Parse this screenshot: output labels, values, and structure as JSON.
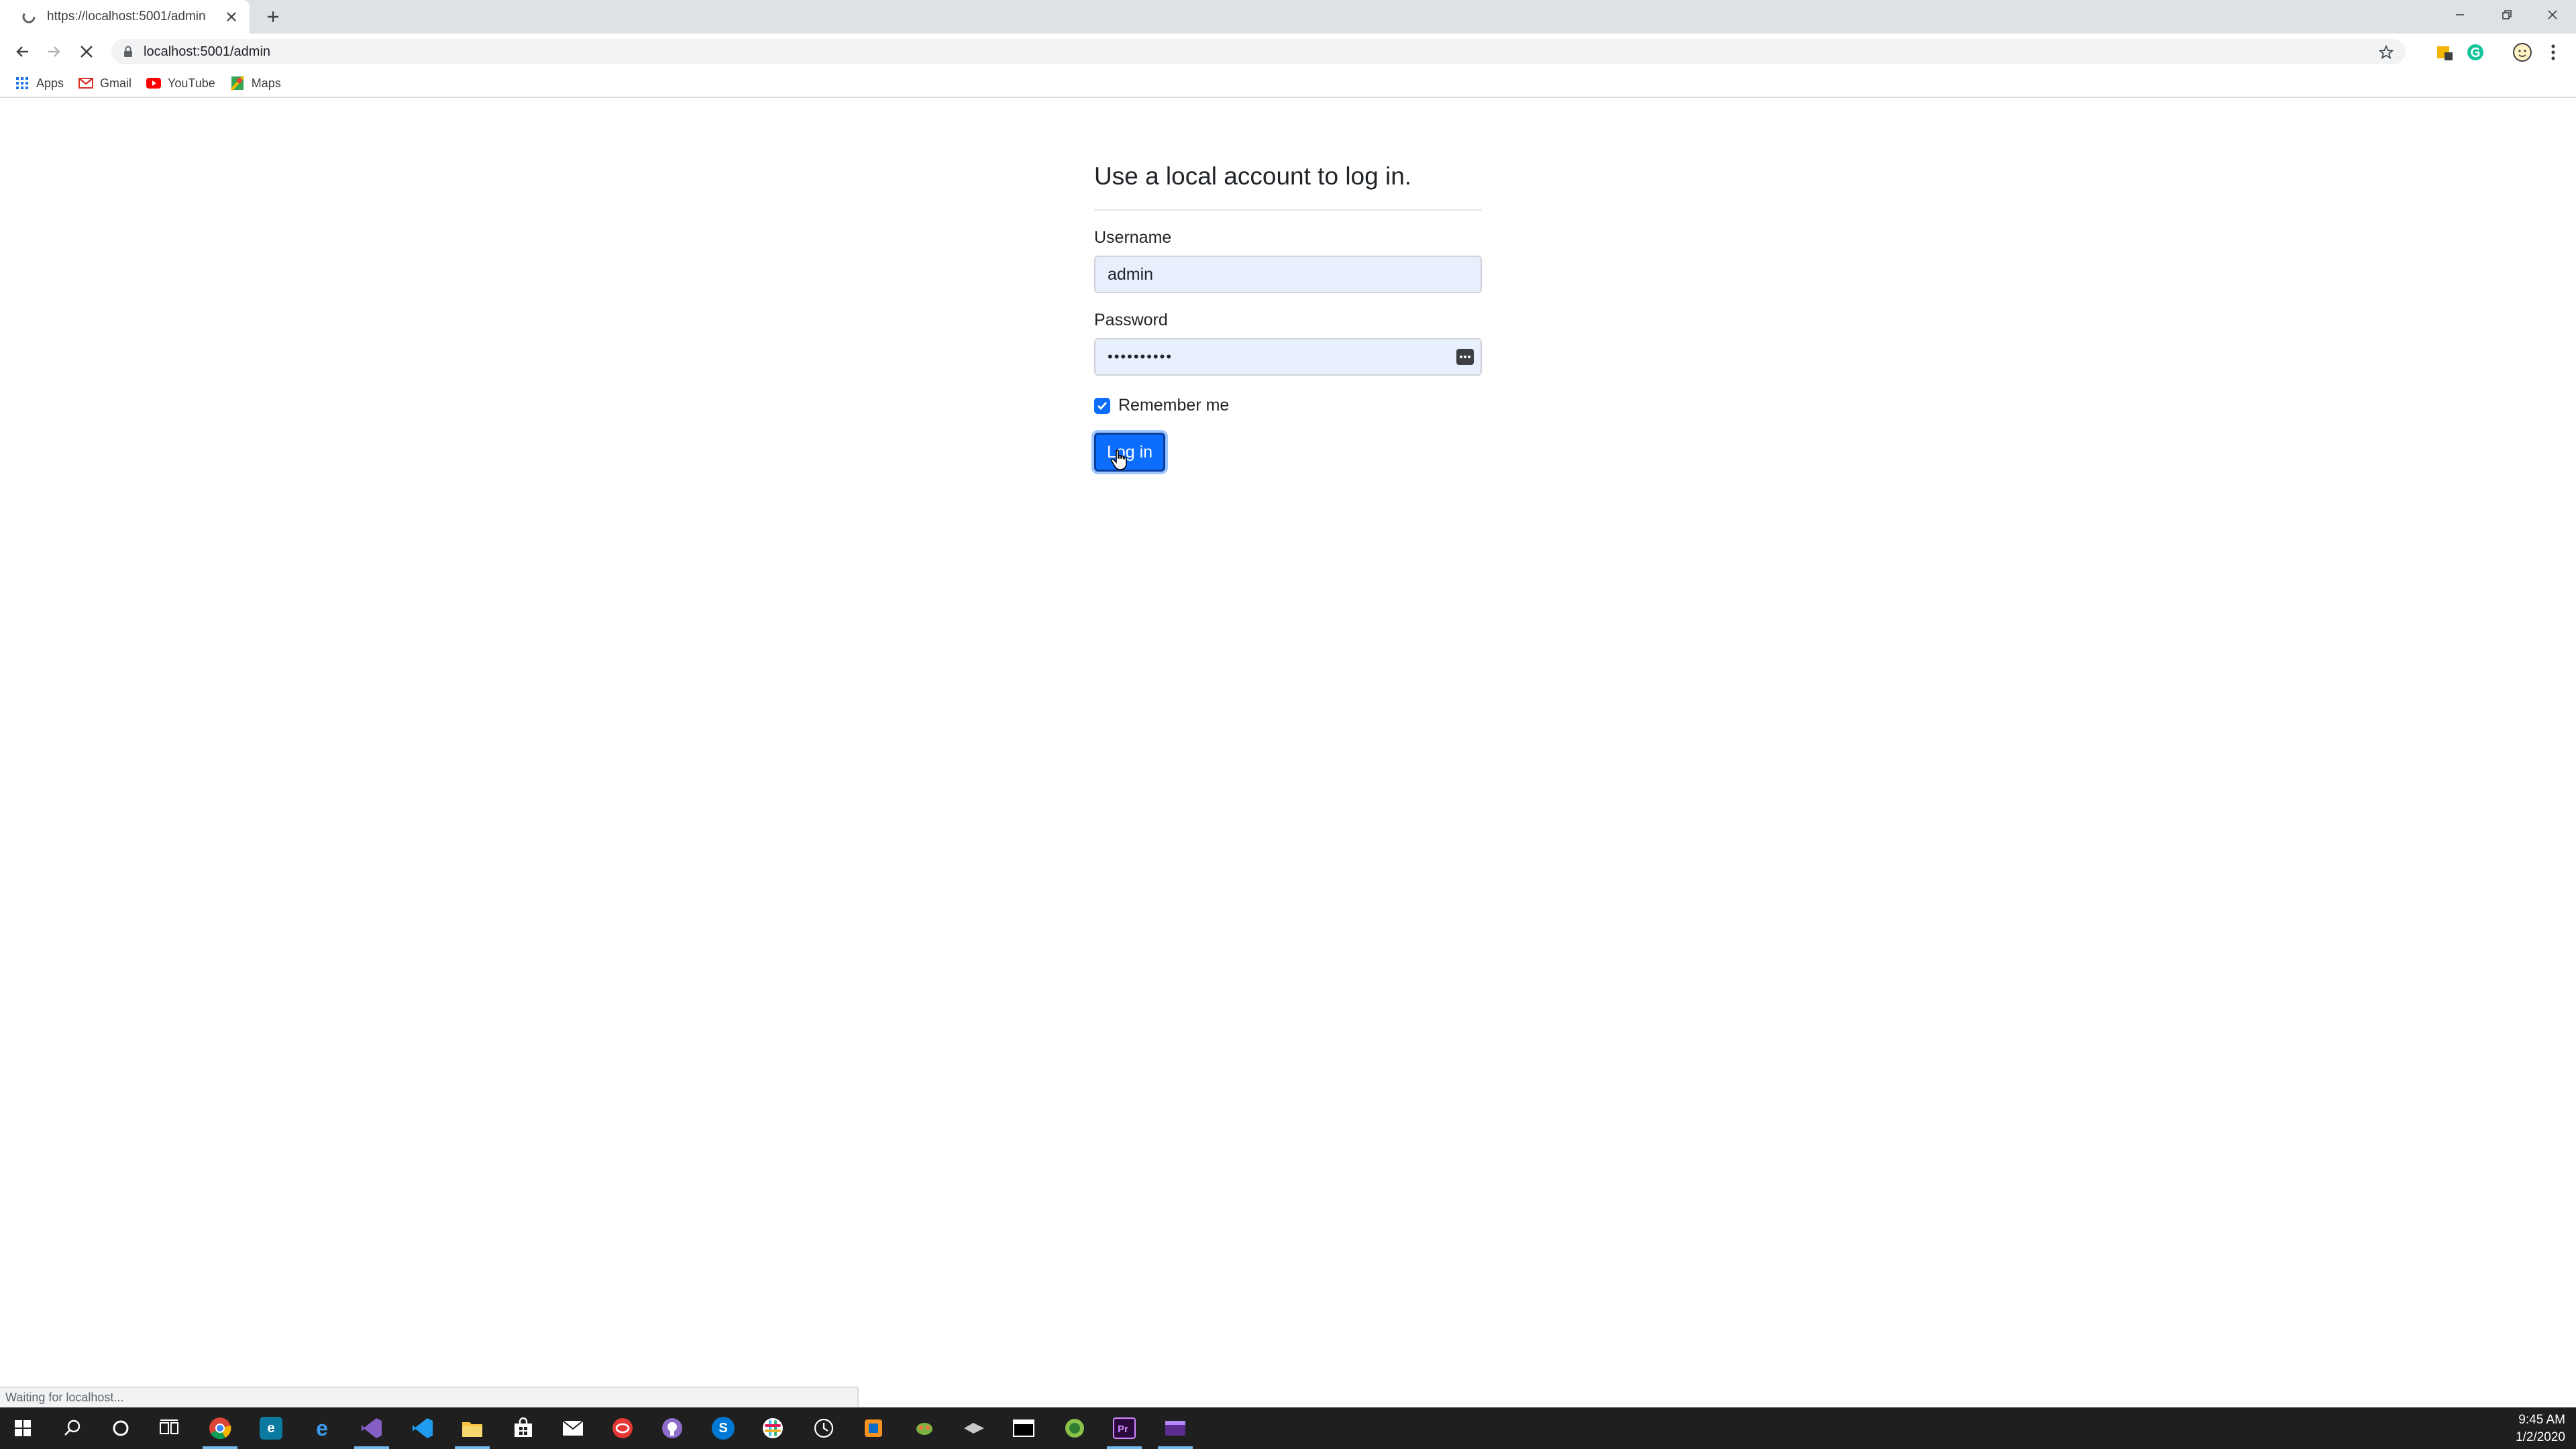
{
  "browser": {
    "tab_title": "https://localhost:5001/admin",
    "url": "localhost:5001/admin",
    "bookmarks": [
      {
        "label": "Apps",
        "icon": "apps-grid-icon"
      },
      {
        "label": "Gmail",
        "icon": "gmail-icon"
      },
      {
        "label": "YouTube",
        "icon": "youtube-icon"
      },
      {
        "label": "Maps",
        "icon": "maps-icon"
      }
    ],
    "status_text": "Waiting for localhost..."
  },
  "login": {
    "heading": "Use a local account to log in.",
    "username_label": "Username",
    "username_value": "admin",
    "password_label": "Password",
    "password_masked": "••••••••••",
    "remember_label": "Remember me",
    "remember_checked": true,
    "submit_label": "Log in"
  },
  "taskbar": {
    "time": "9:45 AM",
    "date": "1/2/2020",
    "apps": [
      "start-icon",
      "search-icon",
      "cortana-icon",
      "task-view-icon",
      "chrome-icon",
      "edge-dev-icon",
      "edge-icon",
      "visual-studio-icon",
      "vscode-icon",
      "file-explorer-icon",
      "store-icon",
      "mail-icon",
      "app-red-icon",
      "github-icon",
      "skype-icon",
      "slack-icon",
      "clock-app-icon",
      "app-orange-icon",
      "app-bug-icon",
      "app-dark-icon",
      "terminal-icon",
      "android-icon",
      "premiere-icon",
      "app-purple-icon"
    ]
  },
  "colors": {
    "primary": "#0d6efd",
    "autofill": "#e8f0fe",
    "taskbar": "#1f1f1f"
  }
}
